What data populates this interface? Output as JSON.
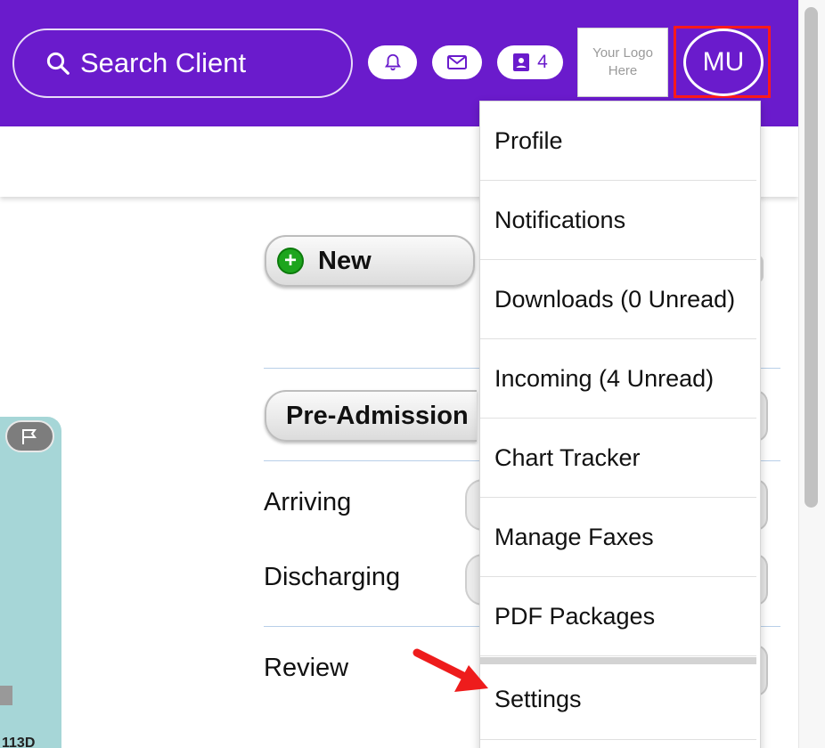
{
  "header": {
    "search_label": "Search Client",
    "contacts_count": "4",
    "logo_text_line1": "Your Logo",
    "logo_text_line2": "Here",
    "avatar_initials": "MU",
    "accent_color": "#6a1bcc"
  },
  "icons": {
    "search": "search-icon",
    "bell": "bell-icon",
    "mail": "mail-icon",
    "contacts": "contact-card-icon",
    "flag": "flag-icon",
    "plus": "plus-icon"
  },
  "main": {
    "new_button_label": "New",
    "pre_admission_label": "Pre-Admission",
    "rows": [
      "Arriving",
      "Discharging",
      "Review"
    ],
    "card_number": "113D"
  },
  "menu": {
    "items": [
      "Profile",
      "Notifications",
      "Downloads (0 Unread)",
      "Incoming (4 Unread)",
      "Chart Tracker",
      "Manage Faxes",
      "PDF Packages",
      "Settings"
    ]
  }
}
